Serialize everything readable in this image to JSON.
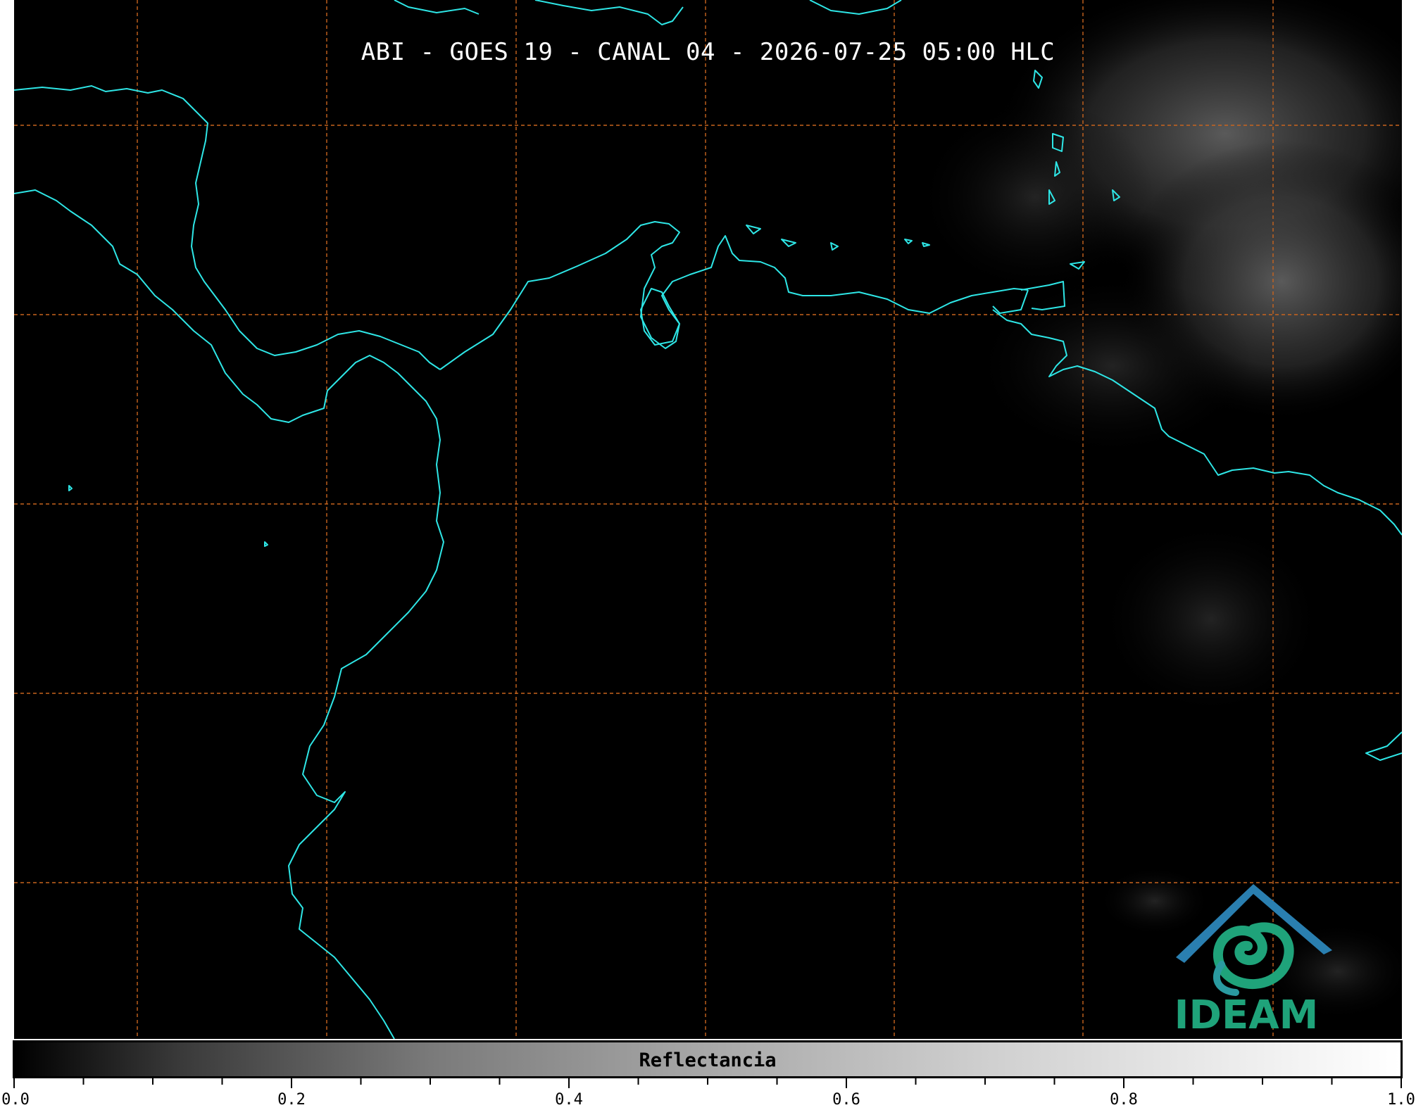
{
  "map": {
    "title": "ABI - GOES 19 - CANAL 04 - 2026-07-25 05:00 HLC",
    "background_color": "#000000",
    "coastline_color": "#2ee6e6",
    "gridline_color": "#c8641e",
    "grid": true
  },
  "colorbar": {
    "label": "Reflectancia",
    "range": [
      0.0,
      1.0
    ],
    "tick_labels": [
      "0.0",
      "0.2",
      "0.4",
      "0.6",
      "0.8",
      "1.0"
    ],
    "tick_values": [
      0.0,
      0.2,
      0.4,
      0.6,
      0.8,
      1.0
    ],
    "minor_tick_step": 0.05,
    "colormap": "grayscale"
  },
  "logo": {
    "text": "IDEAM",
    "roof_color": "#2a7fb0",
    "swirl_color": "#1fa37a"
  }
}
